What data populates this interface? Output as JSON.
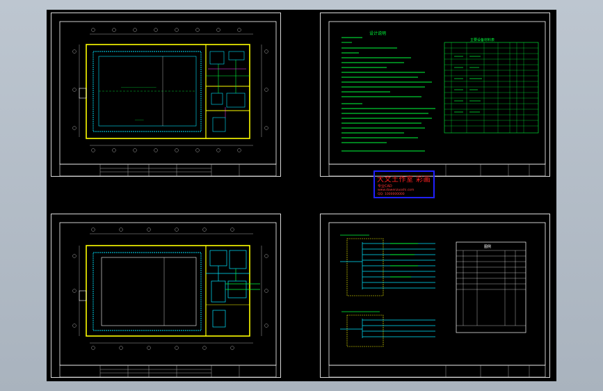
{
  "app": {
    "canvas_background": "#000000",
    "window_background": "#b0b9c4"
  },
  "sheets": [
    {
      "id": "floor-plan-1",
      "kind": "plan",
      "title_block_text": "",
      "drawing_name": "",
      "accent": "#00e5ff"
    },
    {
      "id": "design-notes",
      "kind": "notes",
      "notes_title": "设计说明",
      "table_title": "主要设备材料表",
      "title_block_text": "",
      "accent": "#00ff3c"
    },
    {
      "id": "floor-plan-2",
      "kind": "plan",
      "title_block_text": "",
      "drawing_name": "",
      "accent": "#00e5ff"
    },
    {
      "id": "system-diagram",
      "kind": "diagram",
      "legend_title": "图例",
      "title_block_text": "",
      "accent": "#00ff3c"
    }
  ],
  "watermark": {
    "title": "大文土作室 彩画",
    "subtitle": "专业CAD",
    "url": "www.dawenzuoshi.com",
    "contact": "QQ: 1000000000"
  },
  "colors": {
    "wall": "#ffff00",
    "equipment": "#00e5ff",
    "pipe": "#00ff3c",
    "dim": "#e0e0e0",
    "text_red": "#ff2020",
    "frame": "#ffffff",
    "magenta": "#ff40ff"
  }
}
